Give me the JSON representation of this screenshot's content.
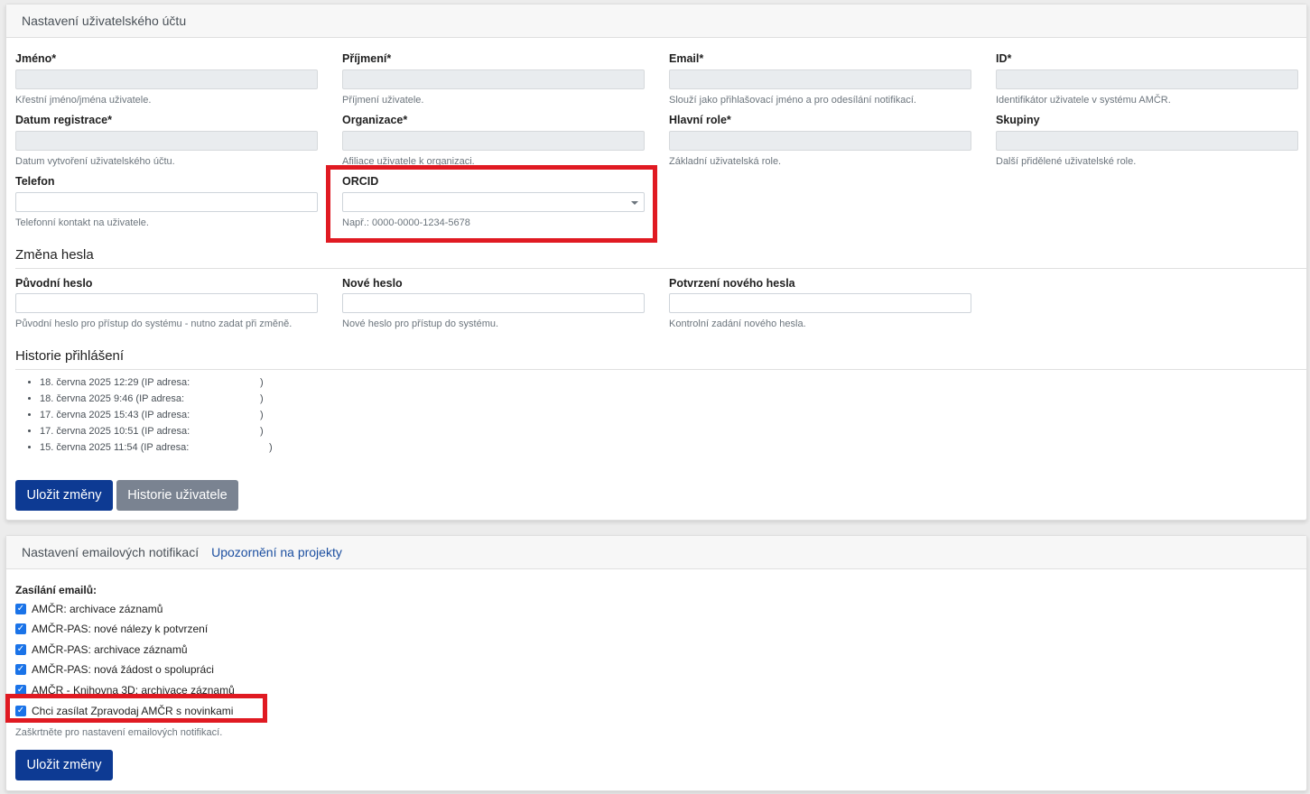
{
  "account": {
    "header": "Nastavení uživatelského účtu",
    "fields": {
      "jmeno": {
        "label": "Jméno*",
        "value": "",
        "help": "Křestní jméno/jména uživatele."
      },
      "prijmeni": {
        "label": "Příjmení*",
        "value": "",
        "help": "Příjmení uživatele."
      },
      "email": {
        "label": "Email*",
        "value": "",
        "help": "Slouží jako přihlašovací jméno a pro odesílání notifikací."
      },
      "id": {
        "label": "ID*",
        "value": "",
        "help": "Identifikátor uživatele v systému AMČR."
      },
      "datum": {
        "label": "Datum registrace*",
        "value": "",
        "help": "Datum vytvoření uživatelského účtu."
      },
      "organizace": {
        "label": "Organizace*",
        "value": "",
        "help": "Afiliace uživatele k organizaci."
      },
      "role": {
        "label": "Hlavní role*",
        "value": "",
        "help": "Základní uživatelská role."
      },
      "skupiny": {
        "label": "Skupiny",
        "value": "",
        "help": "Další přidělené uživatelské role."
      },
      "telefon": {
        "label": "Telefon",
        "value": "",
        "help": "Telefonní kontakt na uživatele."
      },
      "orcid": {
        "label": "ORCID",
        "value": "",
        "help": "Např.: 0000-0000-1234-5678"
      }
    },
    "password": {
      "title": "Změna hesla",
      "original": {
        "label": "Původní heslo",
        "help": "Původní heslo pro přístup do systému - nutno zadat při změně."
      },
      "new": {
        "label": "Nové heslo",
        "help": "Nové heslo pro přístup do systému."
      },
      "confirm": {
        "label": "Potvrzení nového hesla",
        "help": "Kontrolní zadání nového hesla."
      }
    },
    "history": {
      "title": "Historie přihlášení",
      "items": [
        {
          "text": "18. června 2025 12:29 (IP adresa:",
          "close": ")"
        },
        {
          "text": "18. června 2025 9:46 (IP adresa:",
          "close": ")"
        },
        {
          "text": "17. června 2025 15:43 (IP adresa:",
          "close": ")"
        },
        {
          "text": "17. června 2025 10:51 (IP adresa:",
          "close": ")"
        },
        {
          "text": "15. června 2025 11:54 (IP adresa:",
          "close": ")"
        }
      ]
    },
    "buttons": {
      "save": "Uložit změny",
      "history": "Historie uživatele"
    }
  },
  "notifications": {
    "header": "Nastavení emailových notifikací",
    "header_link": "Upozornění na projekty",
    "title": "Zasílání emailů:",
    "items": [
      {
        "label": "AMČR: archivace záznamů",
        "checked": true
      },
      {
        "label": "AMČR-PAS: nové nálezy k potvrzení",
        "checked": true
      },
      {
        "label": "AMČR-PAS: archivace záznamů",
        "checked": true
      },
      {
        "label": "AMČR-PAS: nová žádost o spolupráci",
        "checked": true
      },
      {
        "label": "AMČR - Knihovna 3D: archivace záznamů",
        "checked": true
      },
      {
        "label": "Chci zasílat Zpravodaj AMČR s novinkami",
        "checked": true
      }
    ],
    "help": "Zaškrtněte pro nastavení emailových notifikací.",
    "save": "Uložit změny"
  },
  "highlight_color": "#e01a22",
  "accent_color": "#0d3a93"
}
